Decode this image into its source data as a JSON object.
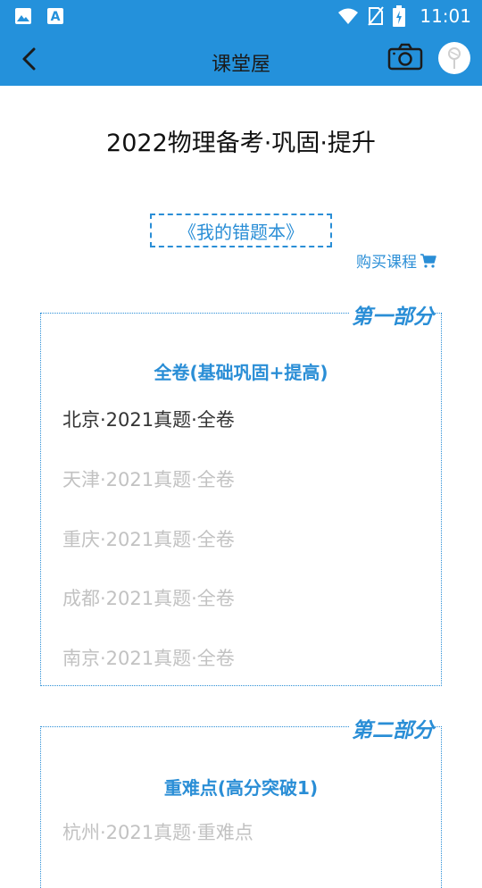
{
  "status_bar": {
    "time": "11:01"
  },
  "app_bar": {
    "title": "课堂屋"
  },
  "page": {
    "heading": "2022物理备考·巩固·提升",
    "notebook_link": "《我的错题本》",
    "buy_course": "购买课程"
  },
  "sections": [
    {
      "label": "第一部分",
      "heading": "全卷(基础巩固+提高)",
      "items": [
        {
          "label": "北京·2021真题·全卷"
        },
        {
          "label": "天津·2021真题·全卷"
        },
        {
          "label": "重庆·2021真题·全卷"
        },
        {
          "label": "成都·2021真题·全卷"
        },
        {
          "label": "南京·2021真题·全卷"
        }
      ]
    },
    {
      "label": "第二部分",
      "heading": "重难点(高分突破1)",
      "items": [
        {
          "label": "杭州·2021真题·重难点"
        }
      ]
    }
  ],
  "colors": {
    "primary": "#2491db",
    "accent": "#2a8ed6",
    "disabled_text": "#c2c2c2"
  }
}
